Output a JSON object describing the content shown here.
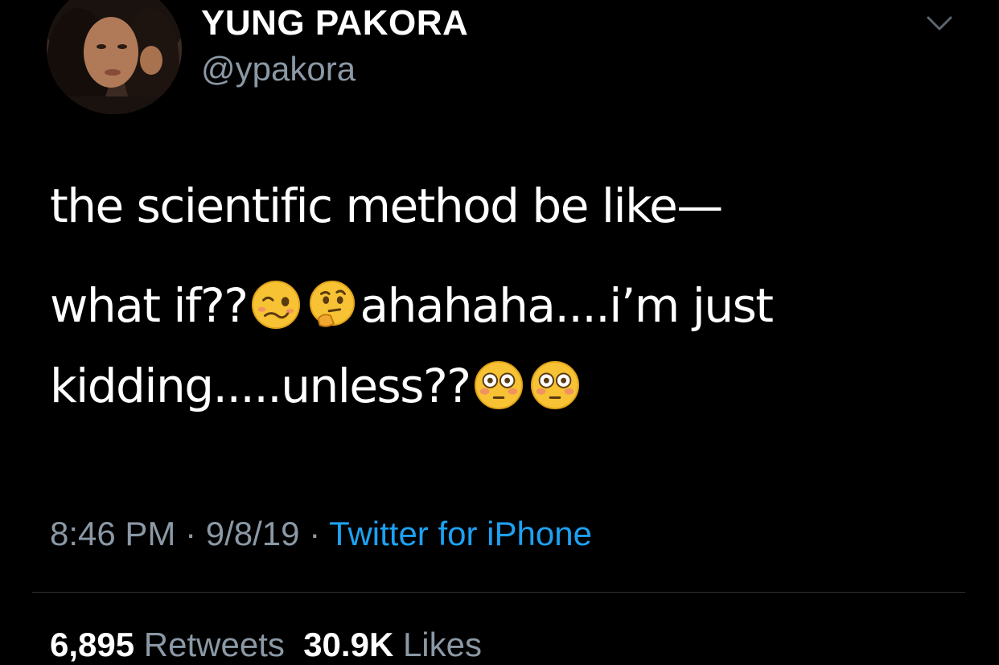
{
  "user": {
    "display_name": "YUNG PAKORA",
    "handle": "@ypakora",
    "avatar_icon": "profile-photo"
  },
  "menu": {
    "icon": "chevron-down-icon"
  },
  "tweet": {
    "line1": "the scientific method be like—",
    "line2_part1": "what if??",
    "line2_part2": "ahahaha....i’m just",
    "line3_part1": "kidding.....unless??",
    "emojis": [
      "woozy-face-icon",
      "thinking-face-icon",
      "flushed-face-icon",
      "flushed-face-icon"
    ]
  },
  "meta": {
    "time": "8:46 PM",
    "separator": " · ",
    "date": "9/8/19",
    "source": "Twitter for iPhone"
  },
  "stats": {
    "retweets_count": "6,895",
    "retweets_label": "Retweets",
    "likes_count": "30.9K",
    "likes_label": "Likes"
  },
  "colors": {
    "background": "#000000",
    "text": "#ffffff",
    "secondary": "#8b98a5",
    "link": "#1da1f2"
  }
}
